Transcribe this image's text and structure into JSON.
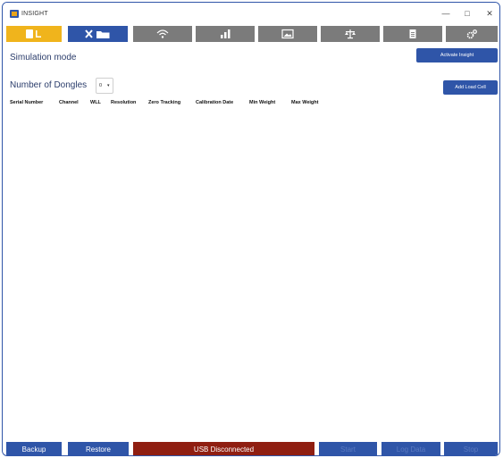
{
  "window": {
    "title": "INSIGHT",
    "controls": {
      "minimize": "—",
      "maximize": "□",
      "close": "✕"
    }
  },
  "tabs": [
    {
      "id": "dongle-load",
      "icon": "dongle-file-icon",
      "state": "active"
    },
    {
      "id": "tools",
      "icon": "tools-folder-icon",
      "state": "selected"
    },
    {
      "id": "wireless",
      "icon": "wifi-icon",
      "state": "inactive"
    },
    {
      "id": "chart",
      "icon": "bar-chart-icon",
      "state": "inactive"
    },
    {
      "id": "image",
      "icon": "image-icon",
      "state": "inactive"
    },
    {
      "id": "scale",
      "icon": "balance-scale-icon",
      "state": "inactive"
    },
    {
      "id": "document",
      "icon": "document-icon",
      "state": "inactive"
    },
    {
      "id": "settings",
      "icon": "settings-gear-icon",
      "state": "inactive"
    }
  ],
  "main": {
    "mode_label": "Simulation mode",
    "activate_button": "Activate Insight",
    "dongles_label": "Number of Dongles",
    "dongles_value": "0",
    "dongles_caret": "▾",
    "add_load_cell_button": "Add Load Cell",
    "columns": [
      "Serial Number",
      "Channel",
      "WLL",
      "Resolution",
      "Zero Tracking",
      "Calibration Date",
      "Min Weight",
      "Max Weight"
    ]
  },
  "bottom": {
    "backup": "Backup",
    "restore": "Restore",
    "usb_status": "USB Disconnected",
    "start": "Start",
    "log_data": "Log Data",
    "stop": "Stop"
  },
  "colors": {
    "brand_blue": "#2f55a8",
    "active_tab": "#f0b41c",
    "inactive_tab": "#7b7b7b",
    "usb_disconnected": "#8f1e11"
  }
}
